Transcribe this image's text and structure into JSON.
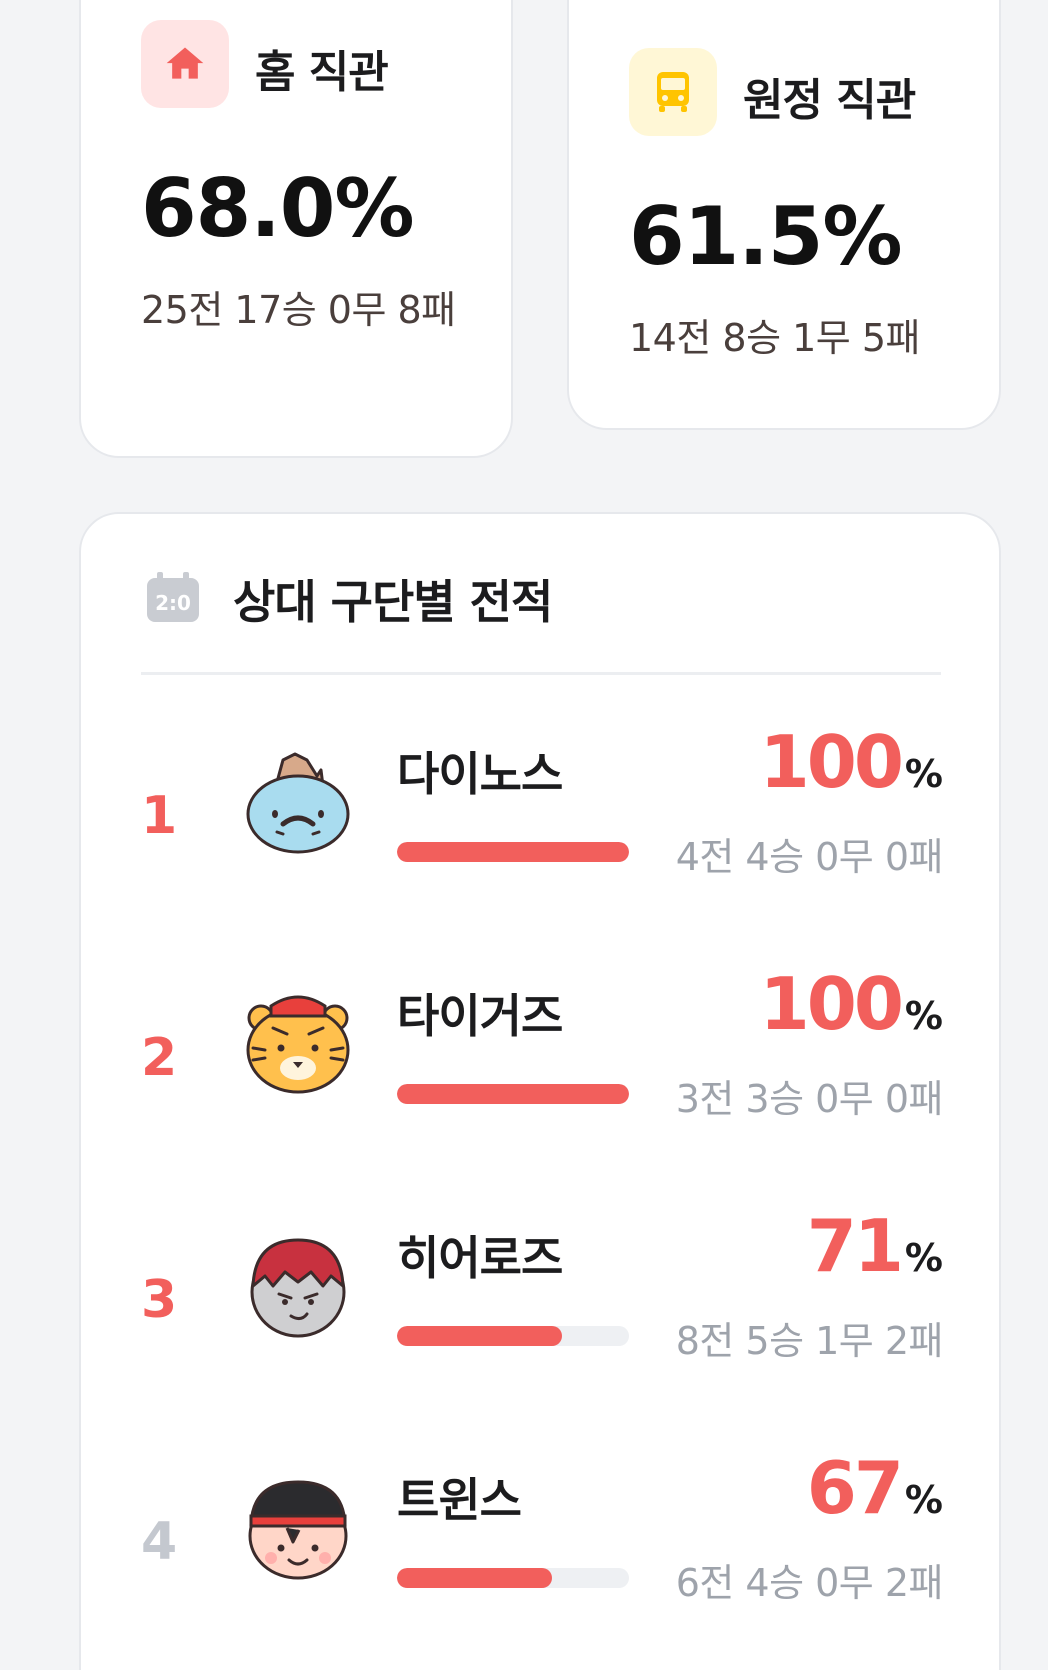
{
  "home": {
    "title": "홈 직관",
    "rate": "68.0%",
    "record": "25전 17승 0무 8패",
    "icon": "home-icon"
  },
  "away": {
    "title": "원정 직관",
    "rate": "61.5%",
    "record": "14전 8승 1무 5패",
    "icon": "bus-icon"
  },
  "opponents": {
    "title": "상대 구단별 전적",
    "icon": "scoreboard-icon",
    "unit": "%",
    "rows": [
      {
        "rank": "1",
        "team": "다이노스",
        "pct": "100",
        "win_rate": 1.0,
        "record": "4전 4승 0무 0패",
        "avatar": "dinosaur-mascot-icon"
      },
      {
        "rank": "2",
        "team": "타이거즈",
        "pct": "100",
        "win_rate": 1.0,
        "record": "3전 3승 0무 0패",
        "avatar": "tiger-mascot-icon"
      },
      {
        "rank": "3",
        "team": "히어로즈",
        "pct": "71",
        "win_rate": 0.71,
        "record": "8전 5승 1무 2패",
        "avatar": "hero-mascot-icon"
      },
      {
        "rank": "4",
        "team": "트윈스",
        "pct": "67",
        "win_rate": 0.67,
        "record": "6전 4승 0무 2패",
        "avatar": "twins-mascot-icon"
      }
    ]
  },
  "colors": {
    "accent": "#f25f5c",
    "home_icon_bg": "#ffe4e4",
    "away_icon_bg": "#fff7d6",
    "away_icon": "#ffc400",
    "muted_text": "#9ea3ab"
  }
}
